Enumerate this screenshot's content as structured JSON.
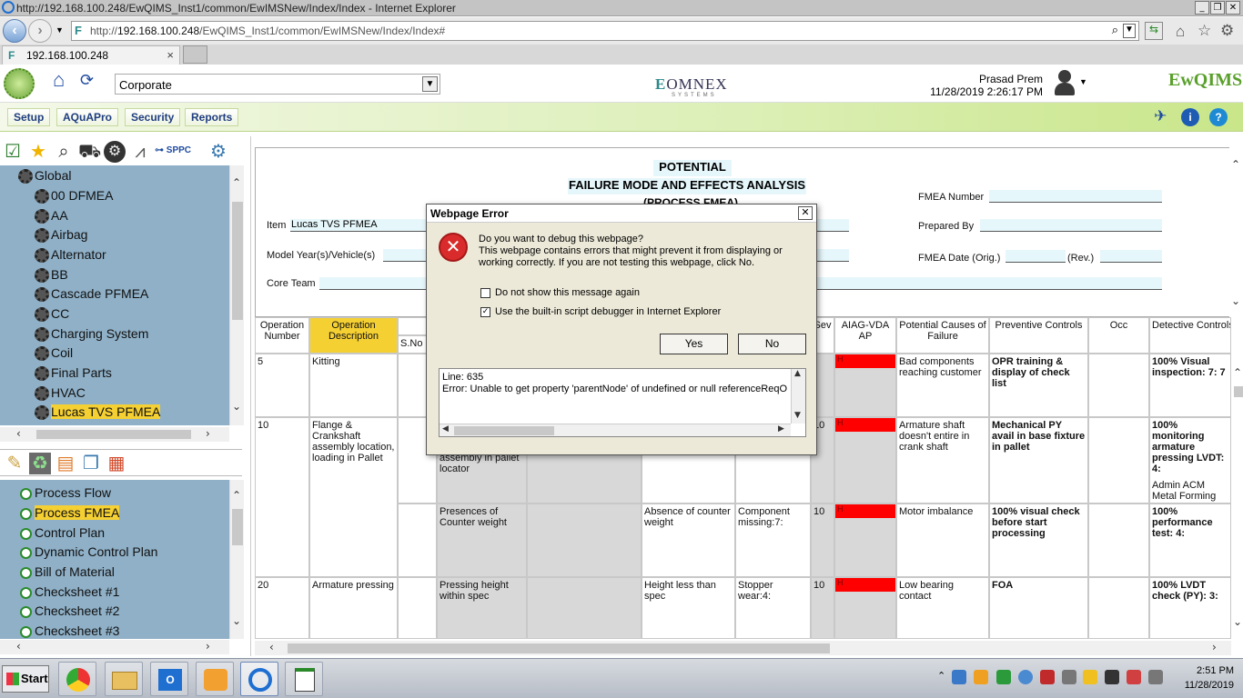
{
  "window": {
    "title": "http://192.168.100.248/EwQIMS_Inst1/common/EwIMSNew/Index/Index - Internet Explorer",
    "url_prefix": "http://",
    "url_host": "192.168.100.248",
    "url_path": "/EwQIMS_Inst1/common/EwIMSNew/Index/Index#",
    "tab_label": "192.168.100.248"
  },
  "app": {
    "corporate_value": "Corporate",
    "center_logo": "OMNEX",
    "center_logo_sub": "SYSTEMS",
    "user_name": "Prasad Prem",
    "user_datetime": "11/28/2019 2:26:17 PM",
    "brand_logo": "EwQIMS",
    "menu": [
      "Setup",
      "AQuAPro",
      "Security",
      "Reports"
    ],
    "toolbar_spc": "SPPC"
  },
  "tree": {
    "root": "Global",
    "items": [
      "00 DFMEA",
      "AA",
      "Airbag",
      "Alternator",
      "BB",
      "Cascade PFMEA",
      "CC",
      "Charging System",
      "Coil",
      "Final Parts",
      "HVAC",
      "Lucas TVS PFMEA"
    ]
  },
  "processes": [
    "Process Flow",
    "Process FMEA",
    "Control Plan",
    "Dynamic Control Plan",
    "Bill of Material",
    "Checksheet #1",
    "Checksheet #2",
    "Checksheet #3"
  ],
  "form": {
    "title1": "POTENTIAL",
    "title2": "FAILURE MODE AND EFFECTS ANALYSIS",
    "title3": "(PROCESS FMEA)",
    "item_label": "Item",
    "item_value": "Lucas TVS PFMEA",
    "model_label": "Model Year(s)/Vehicle(s)",
    "core_label": "Core Team",
    "fmea_number_label": "FMEA Number",
    "prepared_by_label": "Prepared By",
    "fmea_date_label": "FMEA Date (Orig.)",
    "rev_label": "(Rev.)"
  },
  "table": {
    "headers": {
      "op_number": "Operation Number",
      "op_desc": "Operation Description",
      "sno": "S.No",
      "sev": "Sev",
      "aiag": "AIAG-VDA AP",
      "causes": "Potential Causes of Failure",
      "prev": "Preventive Controls",
      "occ": "Occ",
      "detective": "Detective Controls: D"
    },
    "rows": [
      {
        "op": "5",
        "desc": "Kitting",
        "req": "",
        "mode": "",
        "effect": "",
        "sev": "",
        "ap": "H",
        "cause": "Bad components reaching customer",
        "prev": "OPR training & display of check list",
        "det": "100% Visual inspection: 7: 7",
        "det2": ""
      },
      {
        "op": "10",
        "desc": "Flange & Crankshaft assembly location, loading in Pallet",
        "req": "assembly in pallet locator",
        "mode": "",
        "effect": "",
        "sev": "10",
        "ap": "H",
        "cause": "Armature shaft doesn't entire in crank shaft",
        "prev": "Mechanical PY avail in base fixture in pallet",
        "det": "100% monitoring armature pressing LVDT: 4:",
        "det2": "Admin ACM Metal Forming Co."
      },
      {
        "op": "",
        "desc": "",
        "req": "Presences of Counter weight",
        "mode": "Absence of counter weight",
        "effect": "Component missing:7:",
        "sev": "10",
        "ap": "H",
        "cause": "Motor imbalance",
        "prev": "100% visual check before start processing",
        "det": "100% performance test: 4:",
        "det2": ""
      },
      {
        "op": "20",
        "desc": "Armature pressing",
        "req": "Pressing height within spec",
        "mode": "Height less than spec",
        "effect": "Stopper wear:4:",
        "sev": "10",
        "ap": "H",
        "cause": "Low bearing contact",
        "prev": "FOA",
        "det": "100% LVDT check (PY): 3:",
        "det2": ""
      }
    ]
  },
  "dialog": {
    "title": "Webpage Error",
    "question": "Do you want to debug this webpage?",
    "message": "This webpage contains errors that might prevent it from displaying or working correctly. If you are not testing this webpage, click No.",
    "check1": "Do not show this message again",
    "check1_checked": false,
    "check2": "Use the built-in script debugger in Internet Explorer",
    "check2_checked": true,
    "yes": "Yes",
    "no": "No",
    "error_line": "Line: 635",
    "error_text": "Error: Unable to get property 'parentNode' of undefined or null referenceReqO"
  },
  "taskbar": {
    "start": "Start",
    "clock_time": "2:51 PM",
    "clock_date": "11/28/2019"
  },
  "colors": {
    "highlight": "#f5d033",
    "tree_bg": "#8fb0c7",
    "menu_text": "#1f3d80",
    "ap_high": "#ff0000"
  }
}
